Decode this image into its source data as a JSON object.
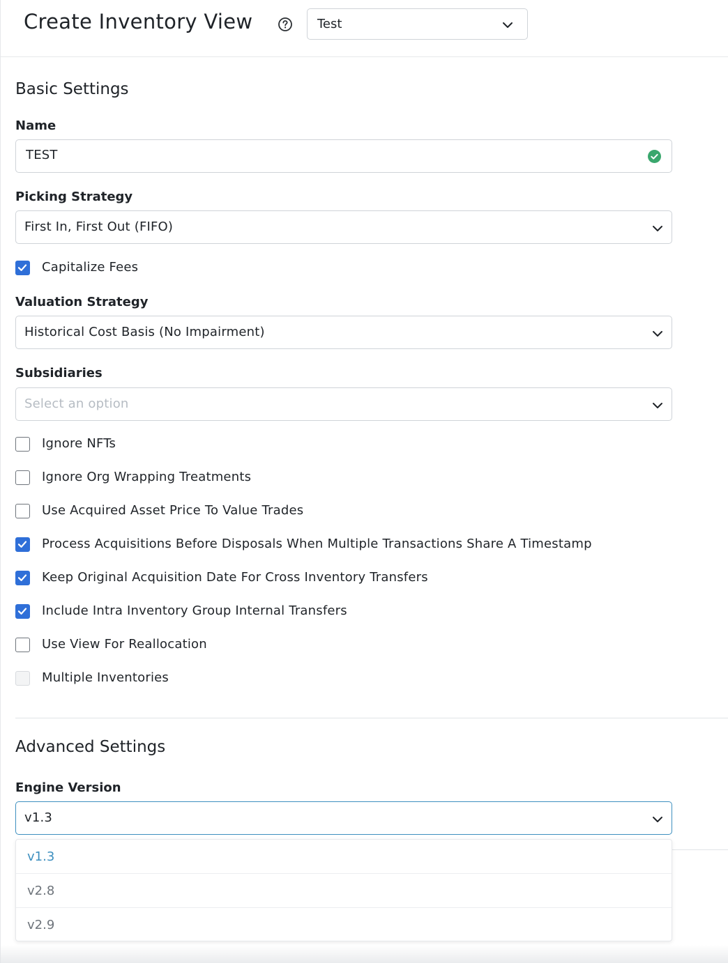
{
  "header": {
    "title": "Create Inventory View",
    "help_icon": "help-circle-icon",
    "view_select_value": "Test"
  },
  "basic": {
    "title": "Basic Settings",
    "name_label": "Name",
    "name_value": "TEST",
    "picking_label": "Picking Strategy",
    "picking_value": "First In, First Out (FIFO)",
    "capitalize_fees": {
      "label": "Capitalize Fees",
      "checked": true
    },
    "valuation_label": "Valuation Strategy",
    "valuation_value": "Historical Cost Basis (No Impairment)",
    "subsidiaries_label": "Subsidiaries",
    "subsidiaries_placeholder": "Select an option",
    "options": [
      {
        "label": "Ignore NFTs",
        "checked": false,
        "disabled": false
      },
      {
        "label": "Ignore Org Wrapping Treatments",
        "checked": false,
        "disabled": false
      },
      {
        "label": "Use Acquired Asset Price To Value Trades",
        "checked": false,
        "disabled": false
      },
      {
        "label": "Process Acquisitions Before Disposals When Multiple Transactions Share A Timestamp",
        "checked": true,
        "disabled": false
      },
      {
        "label": "Keep Original Acquisition Date For Cross Inventory Transfers",
        "checked": true,
        "disabled": false
      },
      {
        "label": "Include Intra Inventory Group Internal Transfers",
        "checked": true,
        "disabled": false
      },
      {
        "label": "Use View For Reallocation",
        "checked": false,
        "disabled": false
      },
      {
        "label": "Multiple Inventories",
        "checked": false,
        "disabled": true
      }
    ]
  },
  "advanced": {
    "title": "Advanced Settings",
    "engine_label": "Engine Version",
    "engine_value": "v1.3",
    "engine_options": [
      {
        "label": "v1.3",
        "selected": true
      },
      {
        "label": "v2.8",
        "selected": false
      },
      {
        "label": "v2.9",
        "selected": false
      }
    ]
  },
  "colors": {
    "accent": "#2f6fd8",
    "selected_option": "#3d8fbf",
    "valid": "#3aa76d"
  }
}
